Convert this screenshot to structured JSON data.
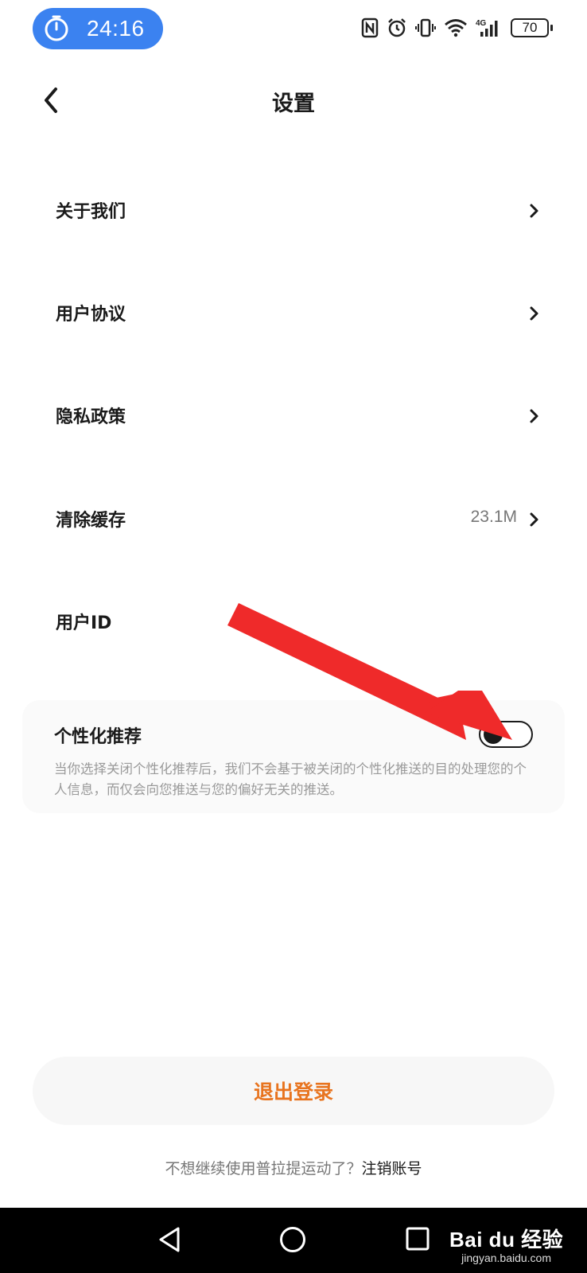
{
  "status_bar": {
    "timer": "24:16",
    "battery": "70",
    "network": "4G"
  },
  "header": {
    "title": "设置",
    "back_icon": "chevron-left-icon"
  },
  "settings": {
    "items": [
      {
        "label": "关于我们",
        "value": "",
        "has_chevron": true
      },
      {
        "label": "用户协议",
        "value": "",
        "has_chevron": true
      },
      {
        "label": "隐私政策",
        "value": "",
        "has_chevron": true
      },
      {
        "label": "清除缓存",
        "value": "23.1M",
        "has_chevron": true
      },
      {
        "label": "用户ID",
        "value": "",
        "has_chevron": false
      }
    ]
  },
  "personalized": {
    "title": "个性化推荐",
    "description": "当你选择关闭个性化推荐后，我们不会基于被关闭的个性化推送的目的处理您的个人信息，而仅会向您推送与您的偏好无关的推送。",
    "enabled": false
  },
  "logout": {
    "label": "退出登录",
    "color": "#e8741f"
  },
  "footer": {
    "prompt": "不想继续使用普拉提运动了？",
    "cancel_link": "注销账号"
  },
  "watermark": {
    "main": "Bai du 经验",
    "sub": "jingyan.baidu.com"
  },
  "colors": {
    "timer_pill": "#3b82f0",
    "annotation_arrow": "#ef2a2a"
  }
}
